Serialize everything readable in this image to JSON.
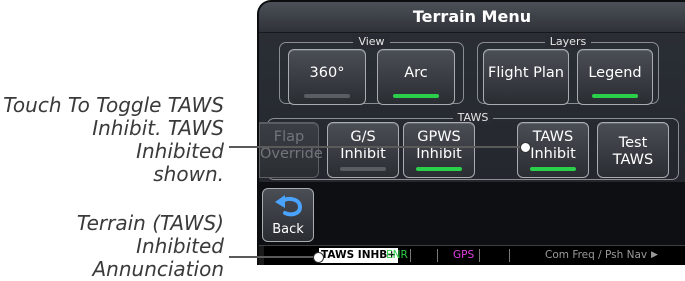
{
  "callouts": {
    "taws_inhibit": [
      "Touch To Toggle TAWS",
      "Inhibit. TAWS Inhibited",
      "shown."
    ],
    "annunciation": [
      "Terrain (TAWS)",
      "Inhibited Annunciation"
    ]
  },
  "menu": {
    "title": "Terrain Menu",
    "view": {
      "label": "View",
      "buttons": [
        {
          "label": "360°",
          "indicator": "off"
        },
        {
          "label": "Arc",
          "indicator": "on"
        }
      ]
    },
    "layers": {
      "label": "Layers",
      "buttons": [
        {
          "label": "Flight Plan"
        },
        {
          "label": "Legend",
          "indicator": "on"
        }
      ]
    },
    "taws": {
      "label": "TAWS",
      "buttons": [
        {
          "line1": "Flap",
          "line2": "Override",
          "disabled": true
        },
        {
          "line1": "G/S",
          "line2": "Inhibit",
          "indicator": "off"
        },
        {
          "line1": "GPWS",
          "line2": "Inhibit",
          "indicator": "on"
        },
        {
          "line1": "TAWS",
          "line2": "Inhibit",
          "indicator": "on"
        },
        {
          "line1": "Test",
          "line2": "TAWS"
        }
      ]
    }
  },
  "back_button": {
    "label": "Back",
    "icon": "back-arrow-icon"
  },
  "status_bar": {
    "annunciation": "TAWS INHB",
    "annunciation_suffix": "+",
    "phase": "ENR",
    "nav_source": "GPS",
    "com_hint": "Com Freq / Psh Nav",
    "colors": {
      "annunciation_bg": "#ffffff",
      "annunciation_text": "#000000",
      "phase": "#2bd04a",
      "nav_source": "#e040e0",
      "com_hint": "#9a9a9a"
    }
  },
  "colors": {
    "indicator_on": "#2bd04a",
    "indicator_off": "#5a5d61"
  }
}
